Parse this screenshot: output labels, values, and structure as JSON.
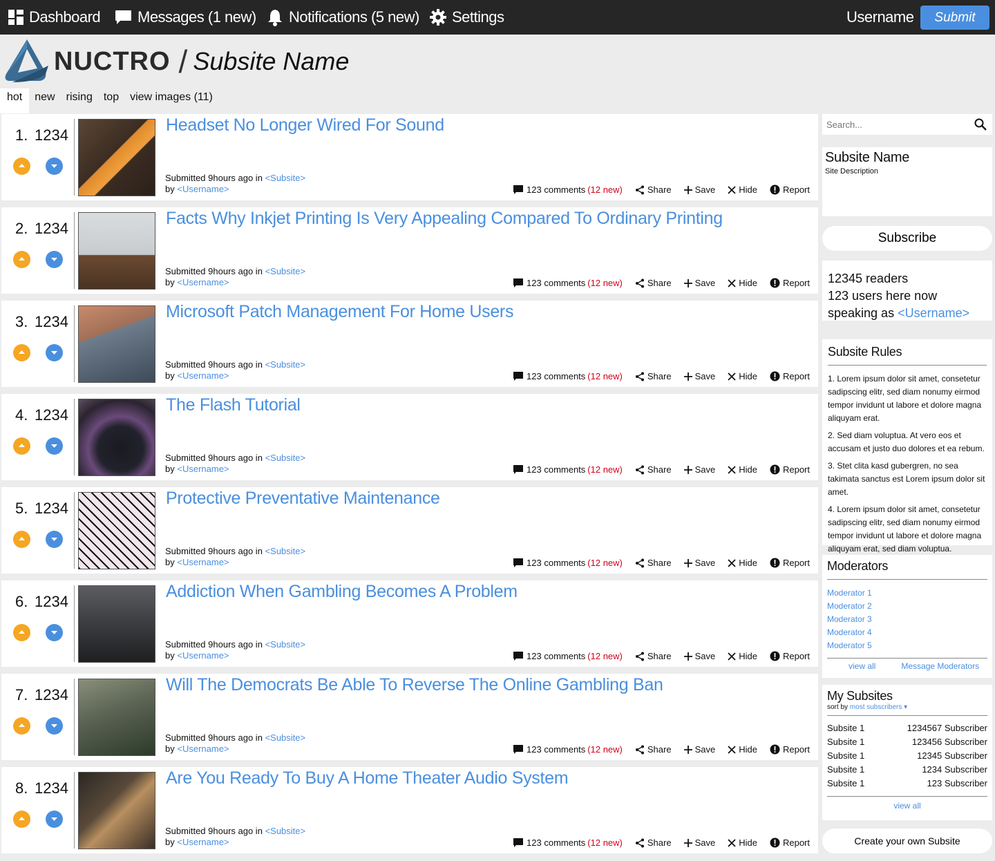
{
  "nav": {
    "dashboard": "Dashboard",
    "messages": "Messages (1 new)",
    "notifications": "Notifications (5 new)",
    "settings": "Settings",
    "username": "Username",
    "submit": "Submit"
  },
  "brand": {
    "name": "NUCTRO",
    "subsite": "Subsite Name"
  },
  "tabs": [
    "hot",
    "new",
    "rising",
    "top",
    "view images (11)"
  ],
  "post_common": {
    "submitted": "Submitted 9hours ago in",
    "subsite": "<Subsite>",
    "by": "by",
    "user": "<Username>",
    "comments": "123 comments",
    "comments_new": "(12 new)",
    "share": "Share",
    "save": "Save",
    "hide": "Hide",
    "report": "Report"
  },
  "posts": [
    {
      "rank": "1.",
      "score": "1234",
      "title": "Headset No Longer Wired For Sound"
    },
    {
      "rank": "2.",
      "score": "1234",
      "title": "Facts Why Inkjet Printing Is Very Appealing Compared To Ordinary Printing"
    },
    {
      "rank": "3.",
      "score": "1234",
      "title": "Microsoft Patch Management For Home Users"
    },
    {
      "rank": "4.",
      "score": "1234",
      "title": "The Flash Tutorial"
    },
    {
      "rank": "5.",
      "score": "1234",
      "title": "Protective Preventative Maintenance"
    },
    {
      "rank": "6.",
      "score": "1234",
      "title": "Addiction When Gambling Becomes A Problem"
    },
    {
      "rank": "7.",
      "score": "1234",
      "title": "Will The Democrats Be Able To Reverse The Online Gambling Ban"
    },
    {
      "rank": "8.",
      "score": "1234",
      "title": "Are You Ready To Buy A Home Theater Audio System"
    }
  ],
  "sidebar": {
    "search_placeholder": "Search...",
    "about_name": "Subsite Name",
    "about_desc": "Site Description",
    "subscribe": "Subscribe",
    "readers": "12345 readers",
    "users_now": "123 users here now",
    "speaking_as": "speaking as",
    "speaking_user": "<Username>",
    "rules_title": "Subsite Rules",
    "rules": [
      "1. Lorem ipsum dolor sit amet, consetetur sadipscing elitr, sed diam nonumy eirmod tempor invidunt ut labore et dolore magna aliquyam erat.",
      "2. Sed diam voluptua. At vero eos et accusam et justo duo dolores et ea rebum.",
      "3. Stet clita kasd gubergren, no sea takimata sanctus est Lorem ipsum dolor sit amet.",
      " 4. Lorem ipsum dolor sit amet, consetetur sadipscing elitr, sed diam nonumy eirmod tempor invidunt ut labore et dolore magna aliquyam erat, sed diam voluptua."
    ],
    "mods_title": "Moderators",
    "mods": [
      "Moderator 1",
      "Moderator 2",
      "Moderator 3",
      "Moderator 4",
      "Moderator 5"
    ],
    "mods_view_all": "view all",
    "mods_message": "Message Moderators",
    "mysubs_title": "My Subsites",
    "mysubs_sort_label": "sort by",
    "mysubs_sort_value": "most subscribers",
    "mysubs": [
      {
        "name": "Subsite 1",
        "count": "1234567 Subscriber"
      },
      {
        "name": "Subsite 1",
        "count": "123456 Subscriber"
      },
      {
        "name": "Subsite 1",
        "count": "12345 Subscriber"
      },
      {
        "name": "Subsite 1",
        "count": "1234 Subscriber"
      },
      {
        "name": "Subsite 1",
        "count": "123 Subscriber"
      }
    ],
    "mysubs_view_all": "view all",
    "create": "Create your own Subsite"
  },
  "colors": {
    "nav_bg": "#262626",
    "accent": "#4a8fdf",
    "upvote": "#f5a623",
    "downvote": "#4a8fdf",
    "new_count": "#d0021b",
    "page_bg": "#ececec"
  }
}
